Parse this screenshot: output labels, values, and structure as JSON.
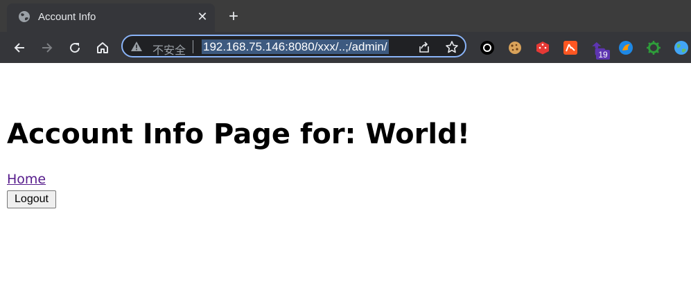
{
  "browser": {
    "tab": {
      "title": "Account Info",
      "favicon": "globe-icon"
    },
    "new_tab_symbol": "+",
    "close_symbol": "✕",
    "address_bar": {
      "security_label": "不安全",
      "url": "192.168.75.146:8080/xxx/..;/admin/",
      "selected": true
    },
    "extensions": [
      {
        "name": "black-ring-extension-icon"
      },
      {
        "name": "cookie-extension-icon"
      },
      {
        "name": "red-dice-extension-icon"
      },
      {
        "name": "translate-extension-icon"
      },
      {
        "name": "purple-extension-icon",
        "badge": "19"
      },
      {
        "name": "blue-fox-extension-icon"
      },
      {
        "name": "green-gear-extension-icon"
      },
      {
        "name": "earth-extension-icon"
      }
    ],
    "colors": {
      "accent": "#8ab4f8",
      "frame": "#3c3c3c",
      "toolbar": "#35363a"
    }
  },
  "page": {
    "heading": "Account Info Page for: World!",
    "home_link": "Home",
    "logout_button": "Logout",
    "colors": {
      "link": "#551a8b"
    }
  }
}
